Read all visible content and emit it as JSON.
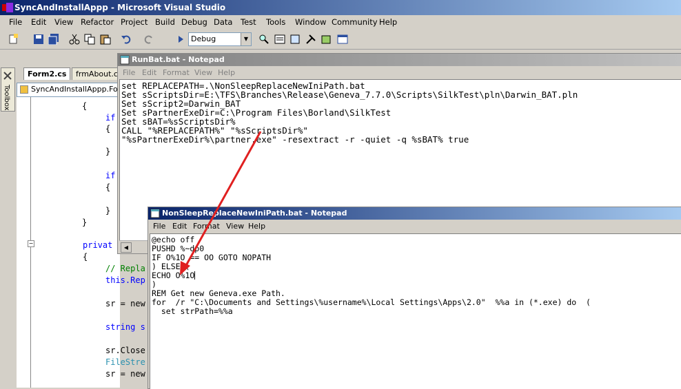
{
  "vs": {
    "title": "SyncAndInstallAppp - Microsoft Visual Studio",
    "menu": [
      "File",
      "Edit",
      "View",
      "Refactor",
      "Project",
      "Build",
      "Debug",
      "Data",
      "Test",
      "Tools",
      "Window",
      "Community",
      "Help"
    ],
    "configuration": "Debug",
    "toolbox_label": "Toolbox",
    "tabs": [
      "Form2.cs",
      "frmAbout.cs"
    ],
    "nav_class": "SyncAndInstallAppp.Form",
    "code_lines": [
      "{",
      "if",
      "{",
      "}",
      "if",
      "{",
      "}",
      "}",
      "privat",
      "{",
      "// Repla",
      "this.Rep",
      "sr = new",
      "string s",
      "sr.Close",
      "FileStre",
      "sr = new"
    ]
  },
  "notepad1": {
    "title": "RunBat.bat - Notepad",
    "menu": [
      "File",
      "Edit",
      "Format",
      "View",
      "Help"
    ],
    "lines": [
      "set REPLACEPATH=.\\NonSleepReplaceNewIniPath.bat",
      "Set sScriptsDir=E:\\TFS\\Branches\\Release\\Geneva_7.7.0\\Scripts\\SilkTest\\pln\\Darwin_BAT.pln",
      "Set sScript2=Darwin_BAT",
      "Set sPartnerExeDir=C:\\Program Files\\Borland\\SilkTest",
      "Set sBAT=%sScriptsDir%",
      "CALL \"%REPLACEPATH%\" \"%sScriptsDir%\"",
      "\"%sPartnerExeDir%\\partner.exe\" -resextract -r -quiet -q %sBAT% true"
    ]
  },
  "notepad2": {
    "title": "NonSleepReplaceNewIniPath.bat - Notepad",
    "menu": [
      "File",
      "Edit",
      "Format",
      "View",
      "Help"
    ],
    "lines": [
      "@echo off",
      "",
      "PUSHD %~dp0",
      "",
      "IF O%1O == OO GOTO NOPATH",
      ") ELSE (",
      "ECHO O%1O",
      ")",
      "",
      "",
      "",
      "",
      "",
      "",
      "REM Get new Geneva.exe Path.",
      "for  /r \"C:\\Documents and Settings\\%username%\\Local Settings\\Apps\\2.0\"  %%a in (*.exe) do  (",
      "  set strPath=%%a"
    ]
  },
  "colors": {
    "arrow": "#e02020",
    "active_title": "#0a246a",
    "inactive_title": "#808080"
  }
}
